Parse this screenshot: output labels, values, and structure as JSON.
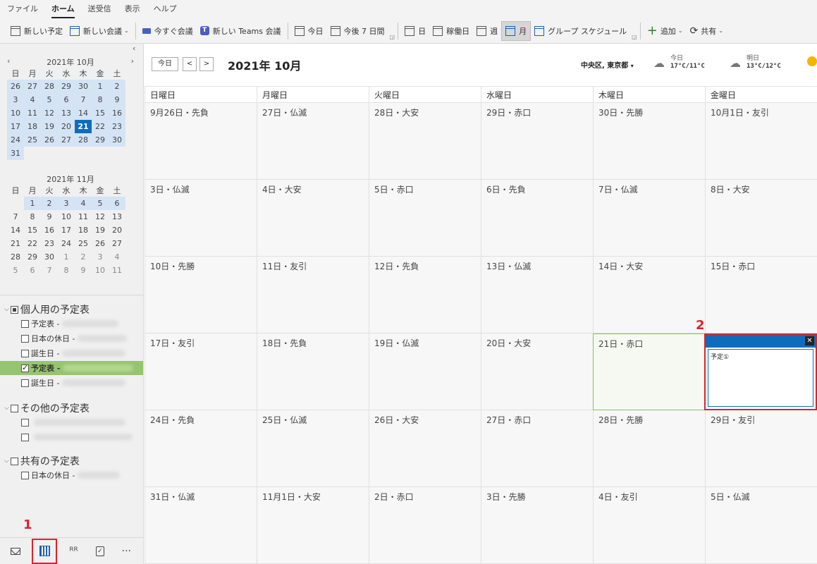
{
  "menu": {
    "items": [
      "ファイル",
      "ホーム",
      "送受信",
      "表示",
      "ヘルプ"
    ],
    "active": "ホーム"
  },
  "ribbon": {
    "new_appointment": "新しい予定",
    "new_meeting": "新しい会議",
    "meet_now": "今すぐ会議",
    "new_teams_meeting": "新しい Teams 会議",
    "today": "今日",
    "next7": "今後 7 日間",
    "day": "日",
    "work_week": "稼働日",
    "week": "週",
    "month": "月",
    "group_schedule": "グループ スケジュール",
    "add": "追加",
    "share": "共有"
  },
  "mini_calendar": {
    "oct_title": "2021年 10月",
    "nov_title": "2021年 11月",
    "dow": [
      "日",
      "月",
      "火",
      "水",
      "木",
      "金",
      "土"
    ],
    "oct_weeks": [
      [
        "26",
        "27",
        "28",
        "29",
        "30",
        "1",
        "2"
      ],
      [
        "3",
        "4",
        "5",
        "6",
        "7",
        "8",
        "9"
      ],
      [
        "10",
        "11",
        "12",
        "13",
        "14",
        "15",
        "16"
      ],
      [
        "17",
        "18",
        "19",
        "20",
        "21",
        "22",
        "23"
      ],
      [
        "24",
        "25",
        "26",
        "27",
        "28",
        "29",
        "30"
      ],
      [
        "31"
      ]
    ],
    "nov_weeks": [
      [
        "",
        "1",
        "2",
        "3",
        "4",
        "5",
        "6"
      ],
      [
        "7",
        "8",
        "9",
        "10",
        "11",
        "12",
        "13"
      ],
      [
        "14",
        "15",
        "16",
        "17",
        "18",
        "19",
        "20"
      ],
      [
        "21",
        "22",
        "23",
        "24",
        "25",
        "26",
        "27"
      ],
      [
        "28",
        "29",
        "30",
        "1",
        "2",
        "3",
        "4"
      ],
      [
        "5",
        "6",
        "7",
        "8",
        "9",
        "10",
        "11"
      ]
    ],
    "today": "21"
  },
  "calendars": {
    "personal_group": "個人用の予定表",
    "personal_items": [
      "予定表 -",
      "日本の休日 -",
      "誕生日 -",
      "予定表 -",
      "誕生日 -"
    ],
    "other_group": "その他の予定表",
    "shared_group": "共有の予定表",
    "shared_items": [
      "日本の休日 -"
    ]
  },
  "header": {
    "today_btn": "今日",
    "prev": "<",
    "next": ">",
    "title": "2021年 10月",
    "location": "中央区, 東京都",
    "today_label": "今日",
    "today_temp": "17°C/11°C",
    "tomorrow_label": "明日",
    "tomorrow_temp": "13°C/12°C"
  },
  "days_of_week": [
    "日曜日",
    "月曜日",
    "火曜日",
    "水曜日",
    "木曜日",
    "金曜日"
  ],
  "weeks": [
    [
      "9月26日・先負",
      "27日・仏滅",
      "28日・大安",
      "29日・赤口",
      "30日・先勝",
      "10月1日・友引"
    ],
    [
      "3日・仏滅",
      "4日・大安",
      "5日・赤口",
      "6日・先負",
      "7日・仏滅",
      "8日・大安"
    ],
    [
      "10日・先勝",
      "11日・友引",
      "12日・先負",
      "13日・仏滅",
      "14日・大安",
      "15日・赤口"
    ],
    [
      "17日・友引",
      "18日・先負",
      "19日・仏滅",
      "20日・大安",
      "21日・赤口",
      ""
    ],
    [
      "24日・先負",
      "25日・仏滅",
      "26日・大安",
      "27日・赤口",
      "28日・先勝",
      "29日・友引"
    ],
    [
      "31日・仏滅",
      "11月1日・大安",
      "2日・赤口",
      "3日・先勝",
      "4日・友引",
      "5日・仏滅"
    ]
  ],
  "event": {
    "title": "予定①"
  },
  "callouts": {
    "one": "1",
    "two": "2"
  },
  "colors": {
    "accent": "#0f6cbd",
    "callout": "#d8242a",
    "selected_calendar": "#97c470"
  }
}
